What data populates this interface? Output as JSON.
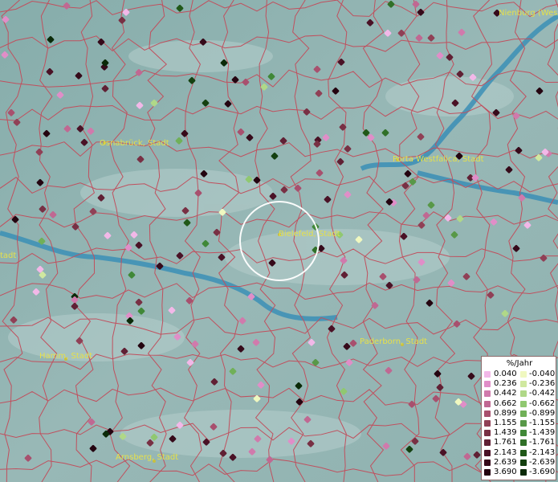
{
  "map": {
    "cities": [
      {
        "name": "Osnabrück, Stadt"
      },
      {
        "name": "Bielefeld, Stadt"
      },
      {
        "name": "Porta Westfalica, Stadt"
      },
      {
        "name": "Paderborn, Stadt"
      },
      {
        "name": "Hamm, Stadt"
      },
      {
        "name": "Arnsberg, Stadt"
      },
      {
        "name": "Nienburg (Wes"
      },
      {
        "name": "tadt"
      }
    ],
    "legend": {
      "title": "%/Jahr",
      "positive": [
        "0.040",
        "0.236",
        "0.442",
        "0.662",
        "0.899",
        "1.155",
        "1.439",
        "1.761",
        "2.143",
        "2.639",
        "3.690"
      ],
      "negative": [
        "-0.040",
        "-0.236",
        "-0.442",
        "-0.662",
        "-0.899",
        "-1.155",
        "-1.439",
        "-1.761",
        "-2.143",
        "-2.639",
        "-3.690"
      ],
      "positive_colors": [
        "#f2b8e8",
        "#e08ec8",
        "#d07aac",
        "#c06892",
        "#a8506e",
        "#904056",
        "#783044",
        "#602034",
        "#4a1226",
        "#360a1a",
        "#240410"
      ],
      "negative_colors": [
        "#f0f8c0",
        "#d0e8a0",
        "#b0d888",
        "#90c870",
        "#70b058",
        "#589848",
        "#408838",
        "#307028",
        "#205818",
        "#144010",
        "#0a2a08"
      ]
    }
  }
}
